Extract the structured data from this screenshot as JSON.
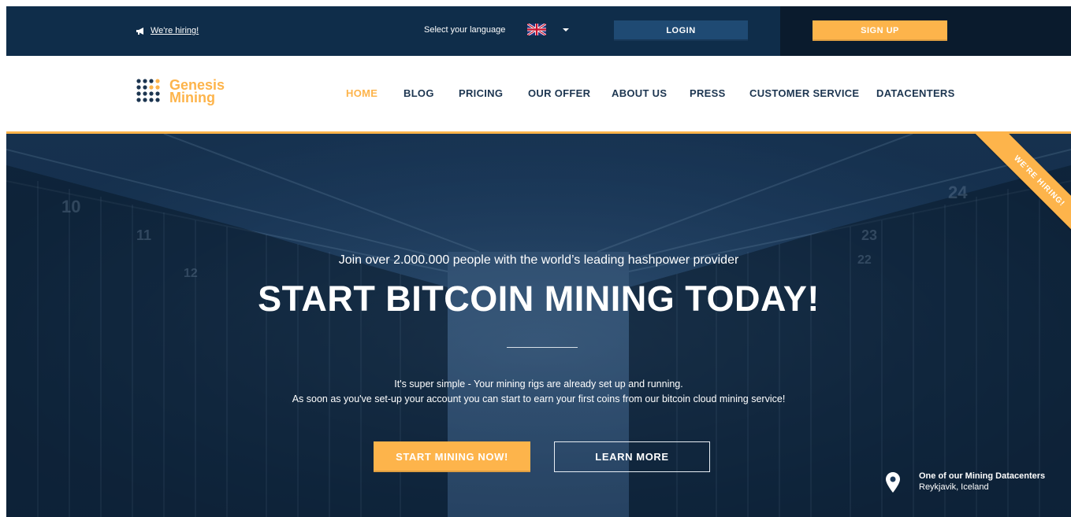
{
  "topbar": {
    "hiring_link": "We're hiring!",
    "language_label": "Select your language",
    "language_flag": "flag-uk",
    "login_label": "LOGIN",
    "signup_label": "SIGN UP"
  },
  "brand": {
    "name_line1": "Genesis",
    "name_line2": "Mining",
    "logo_icon": "dot-grid-logo"
  },
  "nav": {
    "items": [
      {
        "label": "HOME",
        "active": true
      },
      {
        "label": "BLOG",
        "active": false
      },
      {
        "label": "PRICING",
        "active": false
      },
      {
        "label": "OUR OFFER",
        "active": false
      },
      {
        "label": "ABOUT US",
        "active": false
      },
      {
        "label": "PRESS",
        "active": false
      },
      {
        "label": "CUSTOMER SERVICE",
        "active": false
      },
      {
        "label": "DATACENTERS",
        "active": false
      }
    ]
  },
  "hero": {
    "subtitle": "Join over 2.000.000 people with the world’s leading hashpower provider",
    "title": "START BITCOIN MINING TODAY!",
    "desc_line1": "It's super simple - Your mining rigs are already set up and running.",
    "desc_line2": "As soon as you've set-up your account you can start to earn your first coins from our bitcoin cloud mining service!",
    "cta_primary": "START MINING NOW!",
    "cta_secondary": "LEARN MORE",
    "ribbon": "WE'RE HIRING!",
    "location_title": "One of our Mining Datacenters",
    "location_place": "Reykjavik, Iceland"
  },
  "colors": {
    "topbar": "#0f2d4a",
    "accent": "#fdb44b",
    "nav_text": "#1c3550",
    "login_button": "#1f4a73"
  }
}
